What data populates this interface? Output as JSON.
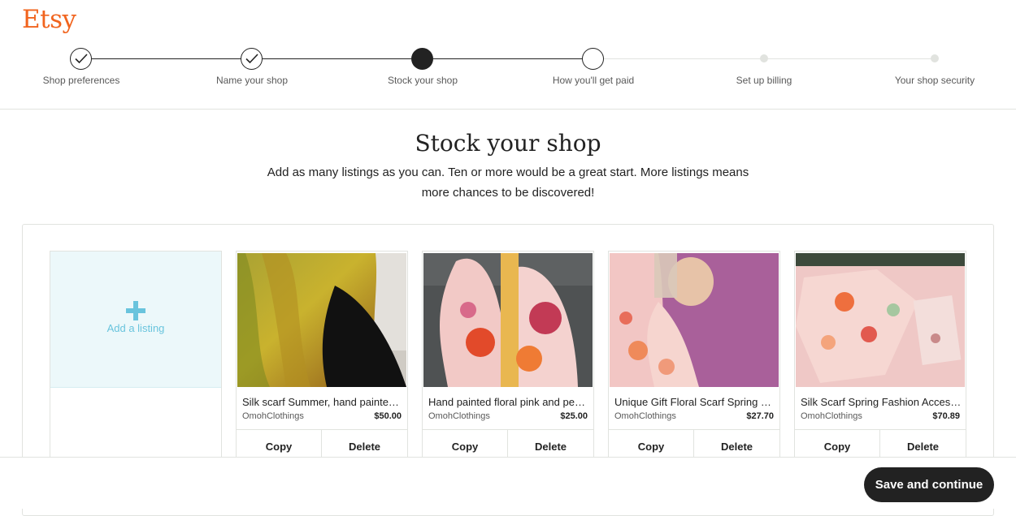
{
  "brand": {
    "logo_text": "Etsy",
    "color": "#f1641e"
  },
  "progress": {
    "steps": [
      {
        "label": "Shop preferences",
        "state": "done"
      },
      {
        "label": "Name your shop",
        "state": "done"
      },
      {
        "label": "Stock your shop",
        "state": "current"
      },
      {
        "label": "How you'll get paid",
        "state": "upcoming"
      },
      {
        "label": "Set up billing",
        "state": "upcoming"
      },
      {
        "label": "Your shop security",
        "state": "upcoming"
      }
    ]
  },
  "main": {
    "title": "Stock your shop",
    "subtitle": "Add as many listings as you can. Ten or more would be a great start. More listings means more chances to be discovered!"
  },
  "add_listing": {
    "label": "Add a listing",
    "icon": "plus-icon"
  },
  "listings": [
    {
      "title": "Silk scarf Summer, hand painted silk scarf",
      "shop": "OmohClothings",
      "price": "$50.00",
      "copy_label": "Copy",
      "delete_label": "Delete"
    },
    {
      "title": "Hand painted floral pink and peach silk scarf",
      "shop": "OmohClothings",
      "price": "$25.00",
      "copy_label": "Copy",
      "delete_label": "Delete"
    },
    {
      "title": "Unique Gift Floral Scarf Spring pastel silk",
      "shop": "OmohClothings",
      "price": "$27.70",
      "copy_label": "Copy",
      "delete_label": "Delete"
    },
    {
      "title": "Silk Scarf Spring Fashion Accessory pink floral",
      "shop": "OmohClothings",
      "price": "$70.89",
      "copy_label": "Copy",
      "delete_label": "Delete"
    }
  ],
  "footer": {
    "save_label": "Save and continue"
  }
}
